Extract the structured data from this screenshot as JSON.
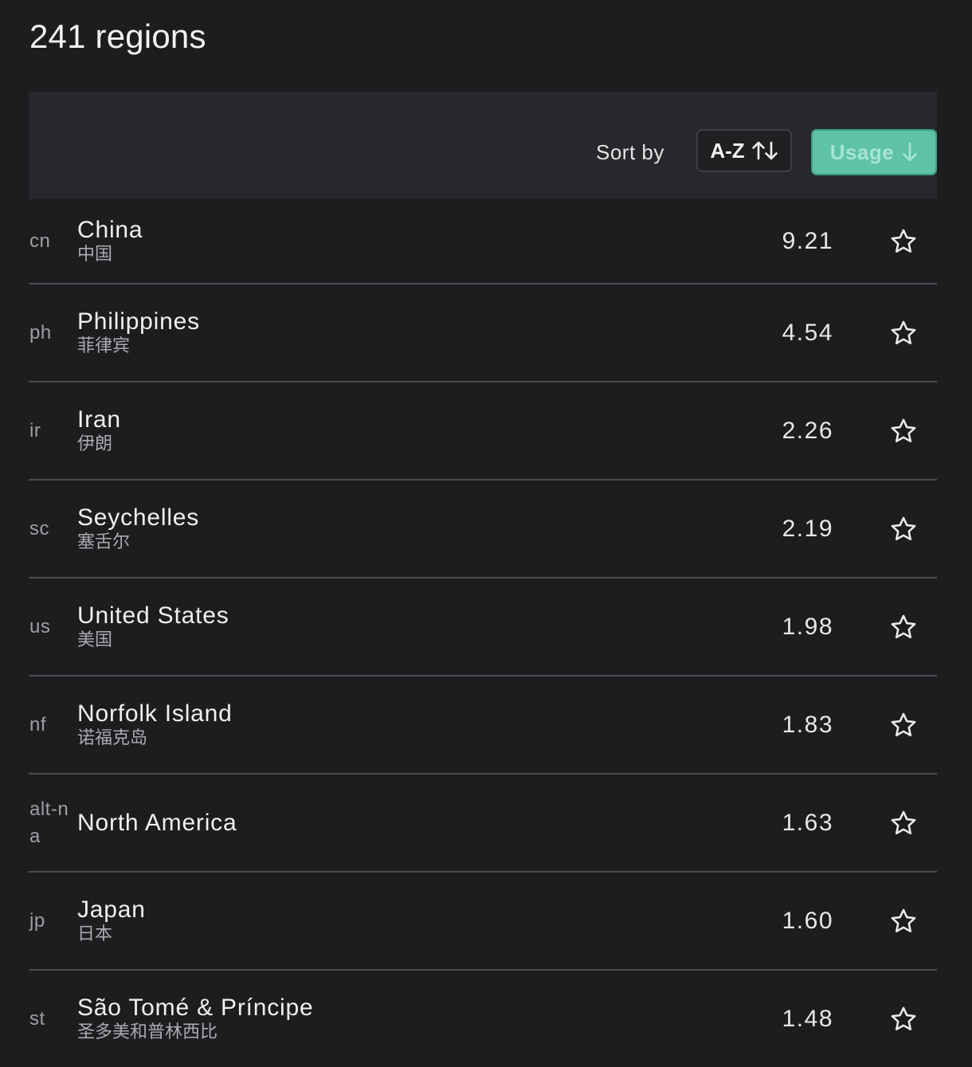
{
  "header": {
    "title": "241 regions"
  },
  "toolbar": {
    "sort_label": "Sort by",
    "az_label": "A-Z",
    "az_icon": "arrows-up-down-icon",
    "usage_label": "Usage",
    "usage_icon": "arrow-down-icon",
    "accent_color": "#5ec3a6"
  },
  "regions": [
    {
      "code": "cn",
      "name": "China",
      "local": "中国",
      "usage": "9.21",
      "star_icon": "star-outline-icon"
    },
    {
      "code": "ph",
      "name": "Philippines",
      "local": "菲律宾",
      "usage": "4.54",
      "star_icon": "star-outline-icon"
    },
    {
      "code": "ir",
      "name": "Iran",
      "local": "伊朗",
      "usage": "2.26",
      "star_icon": "star-outline-icon"
    },
    {
      "code": "sc",
      "name": "Seychelles",
      "local": "塞舌尔",
      "usage": "2.19",
      "star_icon": "star-outline-icon"
    },
    {
      "code": "us",
      "name": "United States",
      "local": "美国",
      "usage": "1.98",
      "star_icon": "star-outline-icon"
    },
    {
      "code": "nf",
      "name": "Norfolk Island",
      "local": "诺福克岛",
      "usage": "1.83",
      "star_icon": "star-outline-icon"
    },
    {
      "code": "alt-na",
      "name": "North America",
      "local": "",
      "usage": "1.63",
      "star_icon": "star-outline-icon"
    },
    {
      "code": "jp",
      "name": "Japan",
      "local": "日本",
      "usage": "1.60",
      "star_icon": "star-outline-icon"
    },
    {
      "code": "st",
      "name": "São Tomé & Príncipe",
      "local": "圣多美和普林西比",
      "usage": "1.48",
      "star_icon": "star-outline-icon"
    }
  ]
}
